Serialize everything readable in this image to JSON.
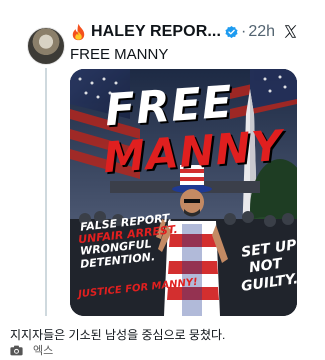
{
  "post": {
    "author_emoji": "🔥",
    "author_name": "HALEY REPOR...",
    "separator": "·",
    "time": "22h",
    "text": "FREE MANNY",
    "icons": [
      "fire-icon",
      "verified-badge-icon",
      "x-logo-icon"
    ],
    "colors": {
      "verified": "#1d9bf0",
      "text": "#0f1419",
      "muted": "#536471"
    }
  },
  "poster": {
    "headline_line1": "FREE",
    "headline_line2": "MANNY",
    "left_lines": [
      "FALSE REPORT.",
      "UNFAIR ARREST.",
      "WRONGFUL",
      "DETENTION."
    ],
    "left_footer": "JUSTICE FOR MANNY!",
    "right_lines": [
      "SET UP",
      "NOT",
      "GUILTY."
    ],
    "colors": {
      "red": "#e01f1f",
      "white": "#ffffff",
      "navy": "#14213d"
    }
  },
  "caption": "지지자들은 기소된 남성을 중심으로 뭉쳤다.",
  "source": {
    "label": "엑스",
    "icon": "camera-icon"
  }
}
